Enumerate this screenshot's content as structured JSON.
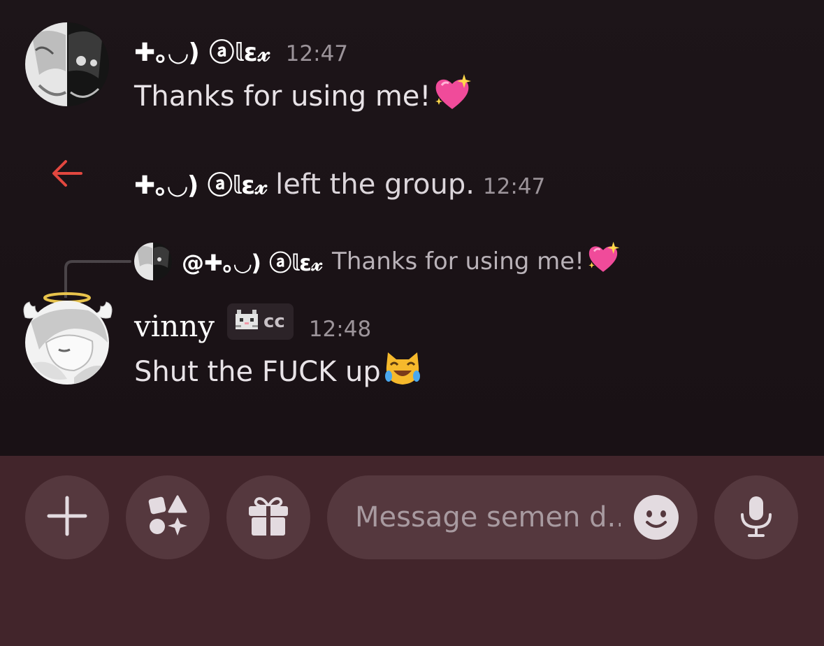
{
  "messages": [
    {
      "author": "✚｡◡)  ⓐ𝕝ε𝓍",
      "time": "12:47",
      "text": "Thanks for using me!",
      "emoji": "sparkling-heart"
    },
    {
      "author": "vinny",
      "tag": "cc",
      "time": "12:48",
      "text": "Shut the FUCK up",
      "emoji": "cat-tears-of-joy"
    }
  ],
  "system": {
    "name": "✚｡◡)  ⓐ𝕝ε𝓍",
    "text": "left the group.",
    "time": "12:47",
    "icon": "arrow-left-icon",
    "icon_color": "#e2473f"
  },
  "reply": {
    "name": "@✚｡◡)  ⓐ𝕝ε𝓍",
    "text": "Thanks for using me!"
  },
  "composer": {
    "placeholder": "Message semen d..",
    "buttons": [
      "plus-icon",
      "apps-icon",
      "gift-icon",
      "emoji-icon",
      "mic-icon"
    ]
  },
  "colors": {
    "background": "#1a1216",
    "composer": "#42252b",
    "button": "#55383e",
    "timestamp": "#9c949a"
  }
}
